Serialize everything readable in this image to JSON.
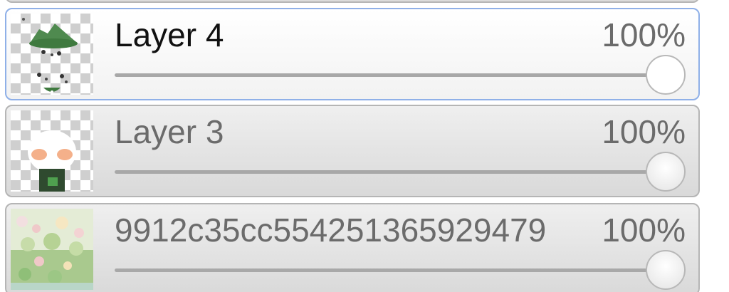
{
  "layers_panel": {
    "layers": [
      {
        "name": "Layer 4",
        "opacity_label": "100%",
        "opacity": 1.0,
        "selected": true,
        "thumbnail": "character-hat-sketch"
      },
      {
        "name": "Layer 3",
        "opacity_label": "100%",
        "opacity": 1.0,
        "selected": false,
        "thumbnail": "character-white-face"
      },
      {
        "name": "9912c35cc554251365929479",
        "opacity_label": "100%",
        "opacity": 1.0,
        "selected": false,
        "thumbnail": "flower-field-background"
      }
    ]
  },
  "colors": {
    "selected_border": "#8fb0e8",
    "row_border": "#b5b5b5",
    "track": "#a8a8a8"
  }
}
